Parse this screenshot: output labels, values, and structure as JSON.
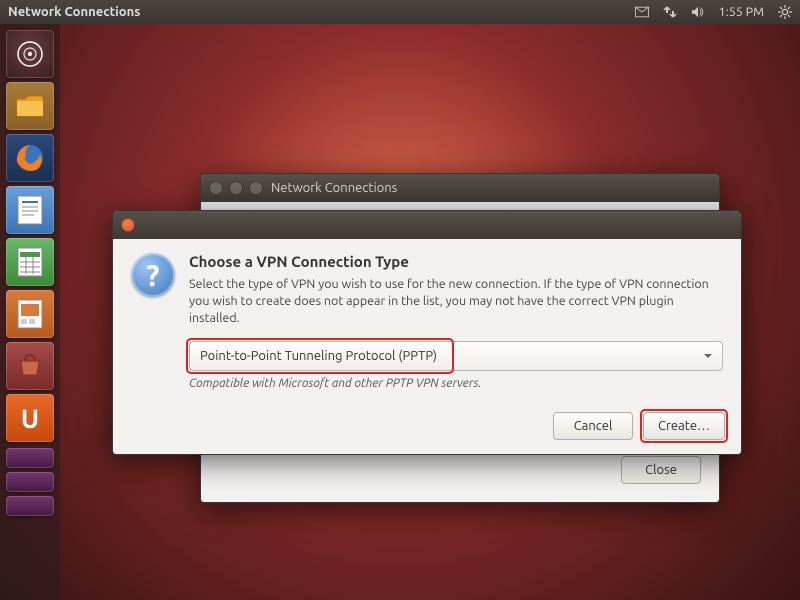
{
  "top_panel": {
    "title": "Network Connections",
    "time": "1:55 PM"
  },
  "launcher": {
    "items": [
      {
        "name": "dash",
        "label": "Dash Home"
      },
      {
        "name": "files",
        "label": "Files"
      },
      {
        "name": "firefox",
        "label": "Firefox"
      },
      {
        "name": "writer",
        "label": "LibreOffice Writer"
      },
      {
        "name": "calc",
        "label": "LibreOffice Calc"
      },
      {
        "name": "impress",
        "label": "LibreOffice Impress"
      },
      {
        "name": "software",
        "label": "Ubuntu Software Center"
      },
      {
        "name": "ubuntu-one",
        "label": "Ubuntu One"
      }
    ]
  },
  "parent_window": {
    "title": "Network Connections",
    "close_label": "Close"
  },
  "dialog": {
    "heading": "Choose a VPN Connection Type",
    "description": "Select the type of VPN you wish to use for the new connection.  If the type of VPN connection you wish to create does not appear in the list, you may not have the correct VPN plugin installed.",
    "selected_option": "Point-to-Point Tunneling Protocol (PPTP)",
    "compat_note": "Compatible with Microsoft and other PPTP VPN servers.",
    "cancel_label": "Cancel",
    "create_label": "Create…"
  }
}
